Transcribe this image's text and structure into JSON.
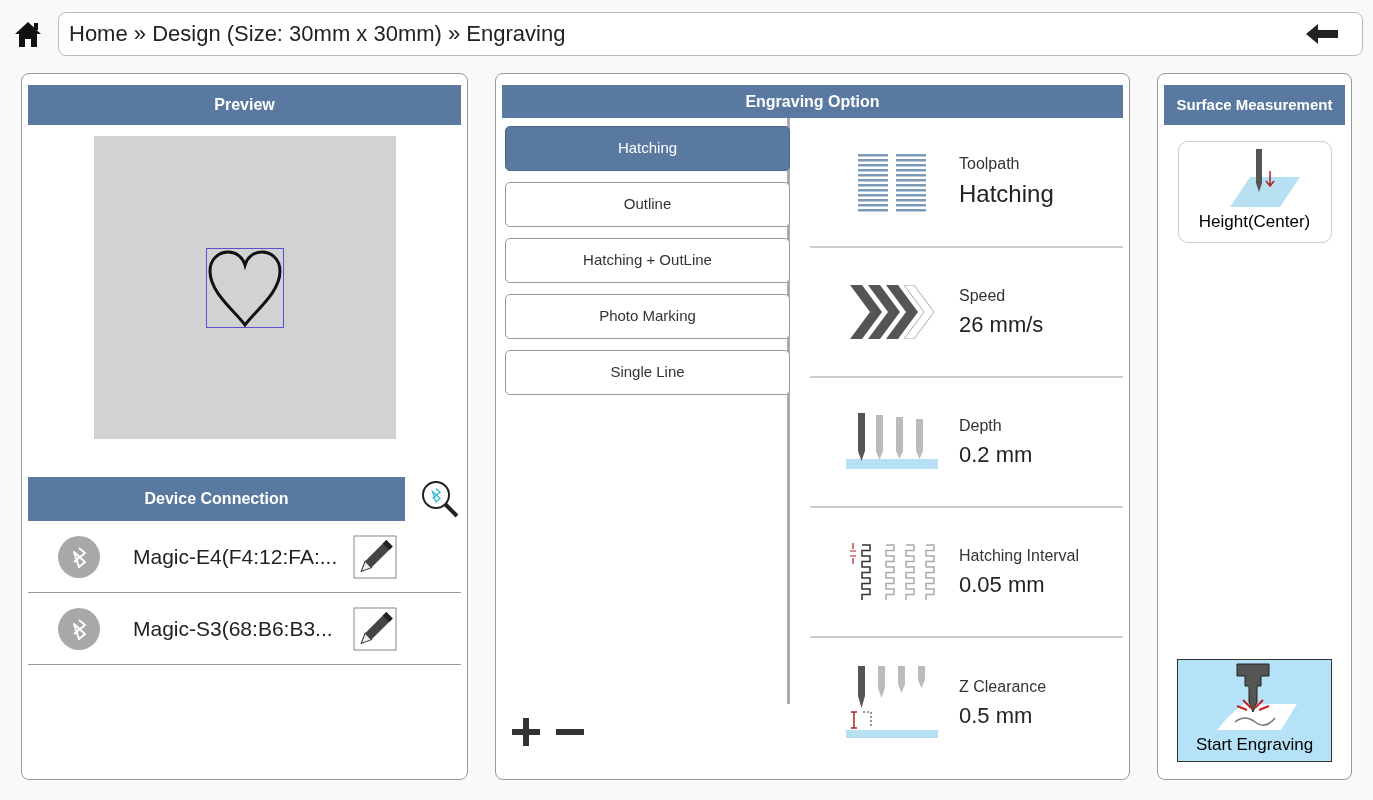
{
  "breadcrumb": {
    "text": "Home » Design (Size: 30mm x 30mm) » Engraving"
  },
  "preview": {
    "title": "Preview"
  },
  "device_connection": {
    "title": "Device Connection",
    "devices": [
      {
        "name": "Magic-E4(F4:12:FA:..."
      },
      {
        "name": "Magic-S3(68:B6:B3..."
      }
    ]
  },
  "engraving_option": {
    "title": "Engraving Option",
    "toolpaths": [
      {
        "label": "Hatching",
        "selected": true
      },
      {
        "label": "Outline",
        "selected": false
      },
      {
        "label": "Hatching + OutLine",
        "selected": false
      },
      {
        "label": "Photo Marking",
        "selected": false
      },
      {
        "label": "Single Line",
        "selected": false
      }
    ],
    "settings": [
      {
        "kind": "toolpath",
        "label": "Toolpath",
        "value": "Hatching"
      },
      {
        "kind": "speed",
        "label": "Speed",
        "value": "26 mm/s"
      },
      {
        "kind": "depth",
        "label": "Depth",
        "value": "0.2 mm"
      },
      {
        "kind": "interval",
        "label": "Hatching Interval",
        "value": "0.05 mm"
      },
      {
        "kind": "clearance",
        "label": "Z Clearance",
        "value": "0.5 mm"
      }
    ]
  },
  "surface_measurement": {
    "title": "Surface Measurement",
    "buttons": [
      {
        "kind": "height",
        "label": "Height(Center)"
      },
      {
        "kind": "start",
        "label": "Start Engraving"
      }
    ]
  }
}
